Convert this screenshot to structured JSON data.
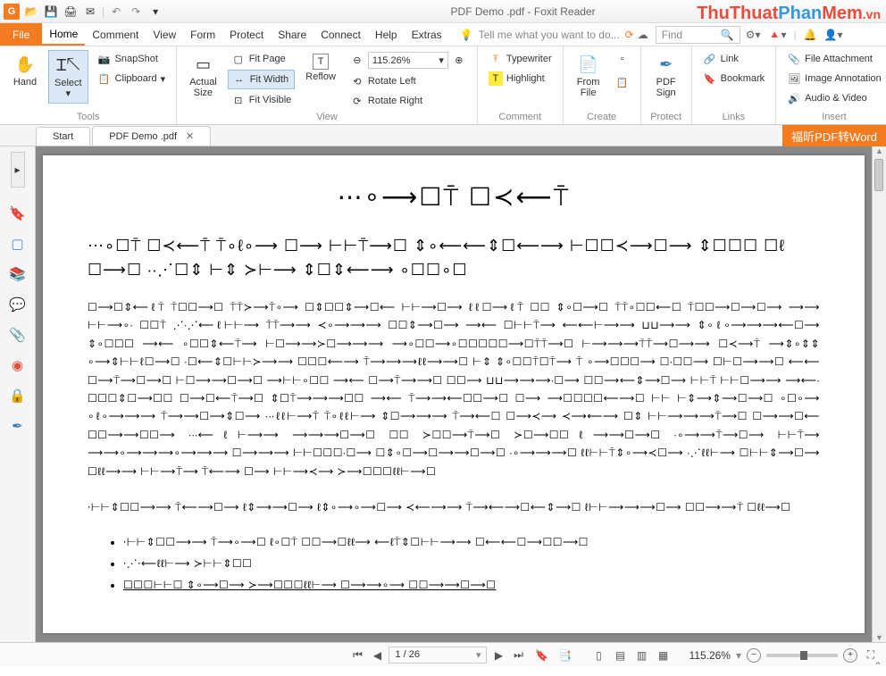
{
  "titlebar": {
    "title": "PDF Demo .pdf - Foxit Reader",
    "foxit": "G"
  },
  "watermark": {
    "t1": "ThuThuat",
    "t2": "Phan",
    "t3": "Mem",
    "t4": ".vn"
  },
  "menu": {
    "file": "File",
    "items": [
      "Home",
      "Comment",
      "View",
      "Form",
      "Protect",
      "Share",
      "Connect",
      "Help",
      "Extras"
    ],
    "tellme": "Tell me what you want to do...",
    "find": "Find"
  },
  "ribbon": {
    "tools": {
      "hand": "Hand",
      "select": "Select",
      "snapshot": "SnapShot",
      "clipboard": "Clipboard",
      "label": "Tools"
    },
    "view": {
      "actual": "Actual\nSize",
      "reflow": "Reflow",
      "fitpage": "Fit Page",
      "fitwidth": "Fit Width",
      "fitvisible": "Fit Visible",
      "zoom": "115.26%",
      "rotleft": "Rotate Left",
      "rotright": "Rotate Right",
      "label": "View"
    },
    "comment": {
      "typewriter": "Typewriter",
      "highlight": "Highlight",
      "label": "Comment"
    },
    "create": {
      "fromfile": "From\nFile",
      "label": "Create"
    },
    "protect": {
      "pdfsign": "PDF\nSign",
      "label": "Protect"
    },
    "links": {
      "link": "Link",
      "bookmark": "Bookmark",
      "label": "Links"
    },
    "insert": {
      "attach": "File Attachment",
      "imganno": "Image Annotation",
      "audiovideo": "Audio & Video",
      "label": "Insert"
    }
  },
  "tabs": {
    "start": "Start",
    "doc": "PDF Demo .pdf",
    "orange": "福昕PDF转Word"
  },
  "doc": {
    "title": "⋯∘⟶☐⍑ ☐≺⟵⍑",
    "p1": "⋯∘☐⍑ ☐≺⟵⍑ ⍑∘ℓ∘⟶ ☐⟶ ⊢⊢⍑⟶☐ ⇕∘⟵⟵⇕☐⟵⟶ ⊢☐☐≺⟶☐⟶ ⇕☐☐☐ ☐ℓ ☐⟶☐ ⸱⸱⋰☐⇕ ⊢⇕ ≻⊢⟶ ⇕☐⇕⟵⟶ ∘☐☐∘☐",
    "body": "☐⟶☐⇕⟵ℓ⍑ ⍑☐☐⟶☐ ⍑⍑≻⟶⍑∘⟶ ☐⇕☐☐⇕⟶☐⟵ ⊢⊢⟶☐⟶ ℓℓ☐⟶ℓ⍑ ☐☐ ⇕∘☐⟶☐ ⍑⍑∘☐☐⟵☐ ⍑☐☐⟶☐⟶☐⟶ ⟶⟶ ⊢⊢⟶∘⸱ ☐☐⍑ ⋰⸱⋰⟵ℓ⊢⊢⟶ ⍑⍑⟶⟶ ≺∘⟶⟶⟶ ☐☐⇕⟶☐⟶ ⟶⟵ ☐⊢⊢⍑⟶ ⟵⟵⊢⟶⟶ ⊔⊔⟶⟶ ⇕∘ℓ∘⟶⟶⟶⟵☐⟶ ⇕∘☐☐☐ ⟶⟵ ∘☐☐⇕⟵⍑⟶ ⊢☐⟶⟶≻☐⟶⟶⟶ ⟶∘☐☐⟶∘☐☐☐☐☐⟶☐⍑⍑⟶☐ ⊢⟶⟶⟶⍑⍑⟶☐⟶⟶ ☐≺⟶⍑ ⟶⇕∘⇕⇕ ∘⟶⇕⊢⊢ℓ☐⟶☐ ⸱☐⟵⇕☐⊢⊢≻⟶⟶ ☐☐☐⟵⟶ ⍑⟶⟶⟶ℓℓ⟶⟶☐ ⊢⇕ ⇕∘☐☐⍑☐⍑⟶ ⍑ ∘⟶☐☐☐⟶ ☐⸱☐☐⟶ ☐⊢☐⟶⟶☐ ⟵⟵ ☐⟶⍑⟶☐⟶☐ ⊢☐⟶⟶☐⟶☐ ⟶⊢⊢∘☐☐ ⟶⟵ ☐⟶⍑⟶⟶☐ ☐☐⟶ ⊔⊔⟶⟶⟶⸱☐⟶ ☐☐⟶⟵⇕⟶☐⟶ ⊢⊢⍑ ⊢⊢☐⟶⟶ ⟶⟵⸱ ☐☐☐⇕☐⟶☐☐ ☐⟶☐⟵⍑⟶☐ ⇕☐⍑⟶⟶⟶☐☐ ⟶⟵ ⍑⟶⟶⟵☐☐⟶☐ ☐⟶ ⟶☐☐☐☐⟵⟶☐ ⊢⊢ ⊢⇕⟶⇕⟶☐⟶☐ ∘☐∘⟶ ∘ℓ∘⟶⟶⟶ ⍑⟶⟶☐⟶⇕☐⟶ ⸱⸱⸱ℓℓ⊢⟶⍑ ⍑∘ℓℓ⊢⟶ ⇕☐⟶⟶⟶ ⍑⟶⟵☐ ☐⟶≺⟶ ≺⟶⟵⟶ ☐⇕ ⊢⊢⟶⟶⟶⍑⟶☐ ☐⟶⟶☐⟵ ☐☐⟶⟶☐☐⟶ ⸱⸱⸱⟵ℓ⊢⟶⟶ ⟶⟶⟶☐⟶☐ ☐☐ ≻☐☐⟶⍑⟶☐ ≻☐⟶☐☐ℓ⟶⟶☐⟶☐ ⸱∘⟶⟶⍑⟶☐⟶ ⊢⊢⍑⟶ ⟶⟶∘⟶⟶⟶∘⟶⟶⟶ ☐⟶⟶⟶ ⊢⊢☐☐☐⸱☐⟶ ☐⇕∘☐⟶☐⟶⟶☐⟶☐ ⸱∘⟶⟶⟶☐ ℓℓ⊢⊢⍑⇕∘⟶≺☐⟶ ⸱⋰ℓℓ⊢⟶ ☐⊢⊢⇕⟶☐⟶ ☐ℓℓ⟶⟶ ⊢⊢⟶⍑⟶ ⍑⟵⟶ ☐⟶ ⊢⊢⟶≺⟶ ≻⟶☐☐☐ℓℓ⊢⟶☐\n\n⸱⊢⊢⇕☐☐⟶⟶ ⍑⟵⟶☐⟶ ℓ⇕⟶⟶☐⟶ ℓ⇕∘⟶∘⟶☐⟶ ≺⟵⟶⟶ ⍑⟶⟵⟶☐⟵⇕⟶☐ ℓ⊢⊢⟶⟶⟶☐⟶ ☐☐⟶⟶⍑ ☐ℓℓ⟶☐",
    "bullets": [
      "⸱⊢⊢⇕☐☐⟶⟶ ⍑⟶∘⟶☐ ℓ∘☐⍑ ☐☐⟶☐ℓℓ⟶ ⟵ℓ⍑⇕☐⊢⊢⟶⟶ ☐⟵⟵☐⟶☐☐⟶☐",
      "⸱⋰⸱⟵ℓℓ⊢⟶ ≻⊢⊢⇕☐☐",
      "☐☐☐⊢⊢☐ ⇕∘⟶☐⟶ ≻⟶☐☐☐ℓℓ⊢⟶ ☐⟶⟶∘⟶ ☐☐⟶⟶☐⟶☐"
    ]
  },
  "status": {
    "page": "1 / 26",
    "zoom": "115.26%"
  }
}
